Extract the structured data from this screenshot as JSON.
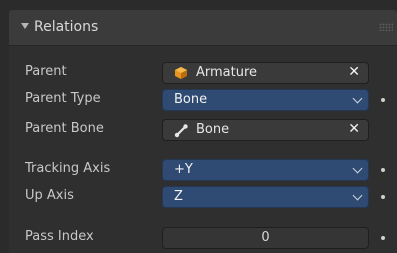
{
  "panel": {
    "title": "Relations"
  },
  "fields": {
    "parent": {
      "label": "Parent",
      "value": "Armature",
      "icon": "armature-object-icon",
      "clear": "✕"
    },
    "parent_type": {
      "label": "Parent Type",
      "value": "Bone"
    },
    "parent_bone": {
      "label": "Parent Bone",
      "value": "Bone",
      "icon": "bone-icon",
      "clear": "✕"
    },
    "tracking_axis": {
      "label": "Tracking Axis",
      "value": "+Y"
    },
    "up_axis": {
      "label": "Up Axis",
      "value": "Z"
    },
    "pass_index": {
      "label": "Pass Index",
      "value": "0"
    }
  },
  "colors": {
    "select_bg": "#2f4a73",
    "armature_icon": "#e8951d"
  }
}
